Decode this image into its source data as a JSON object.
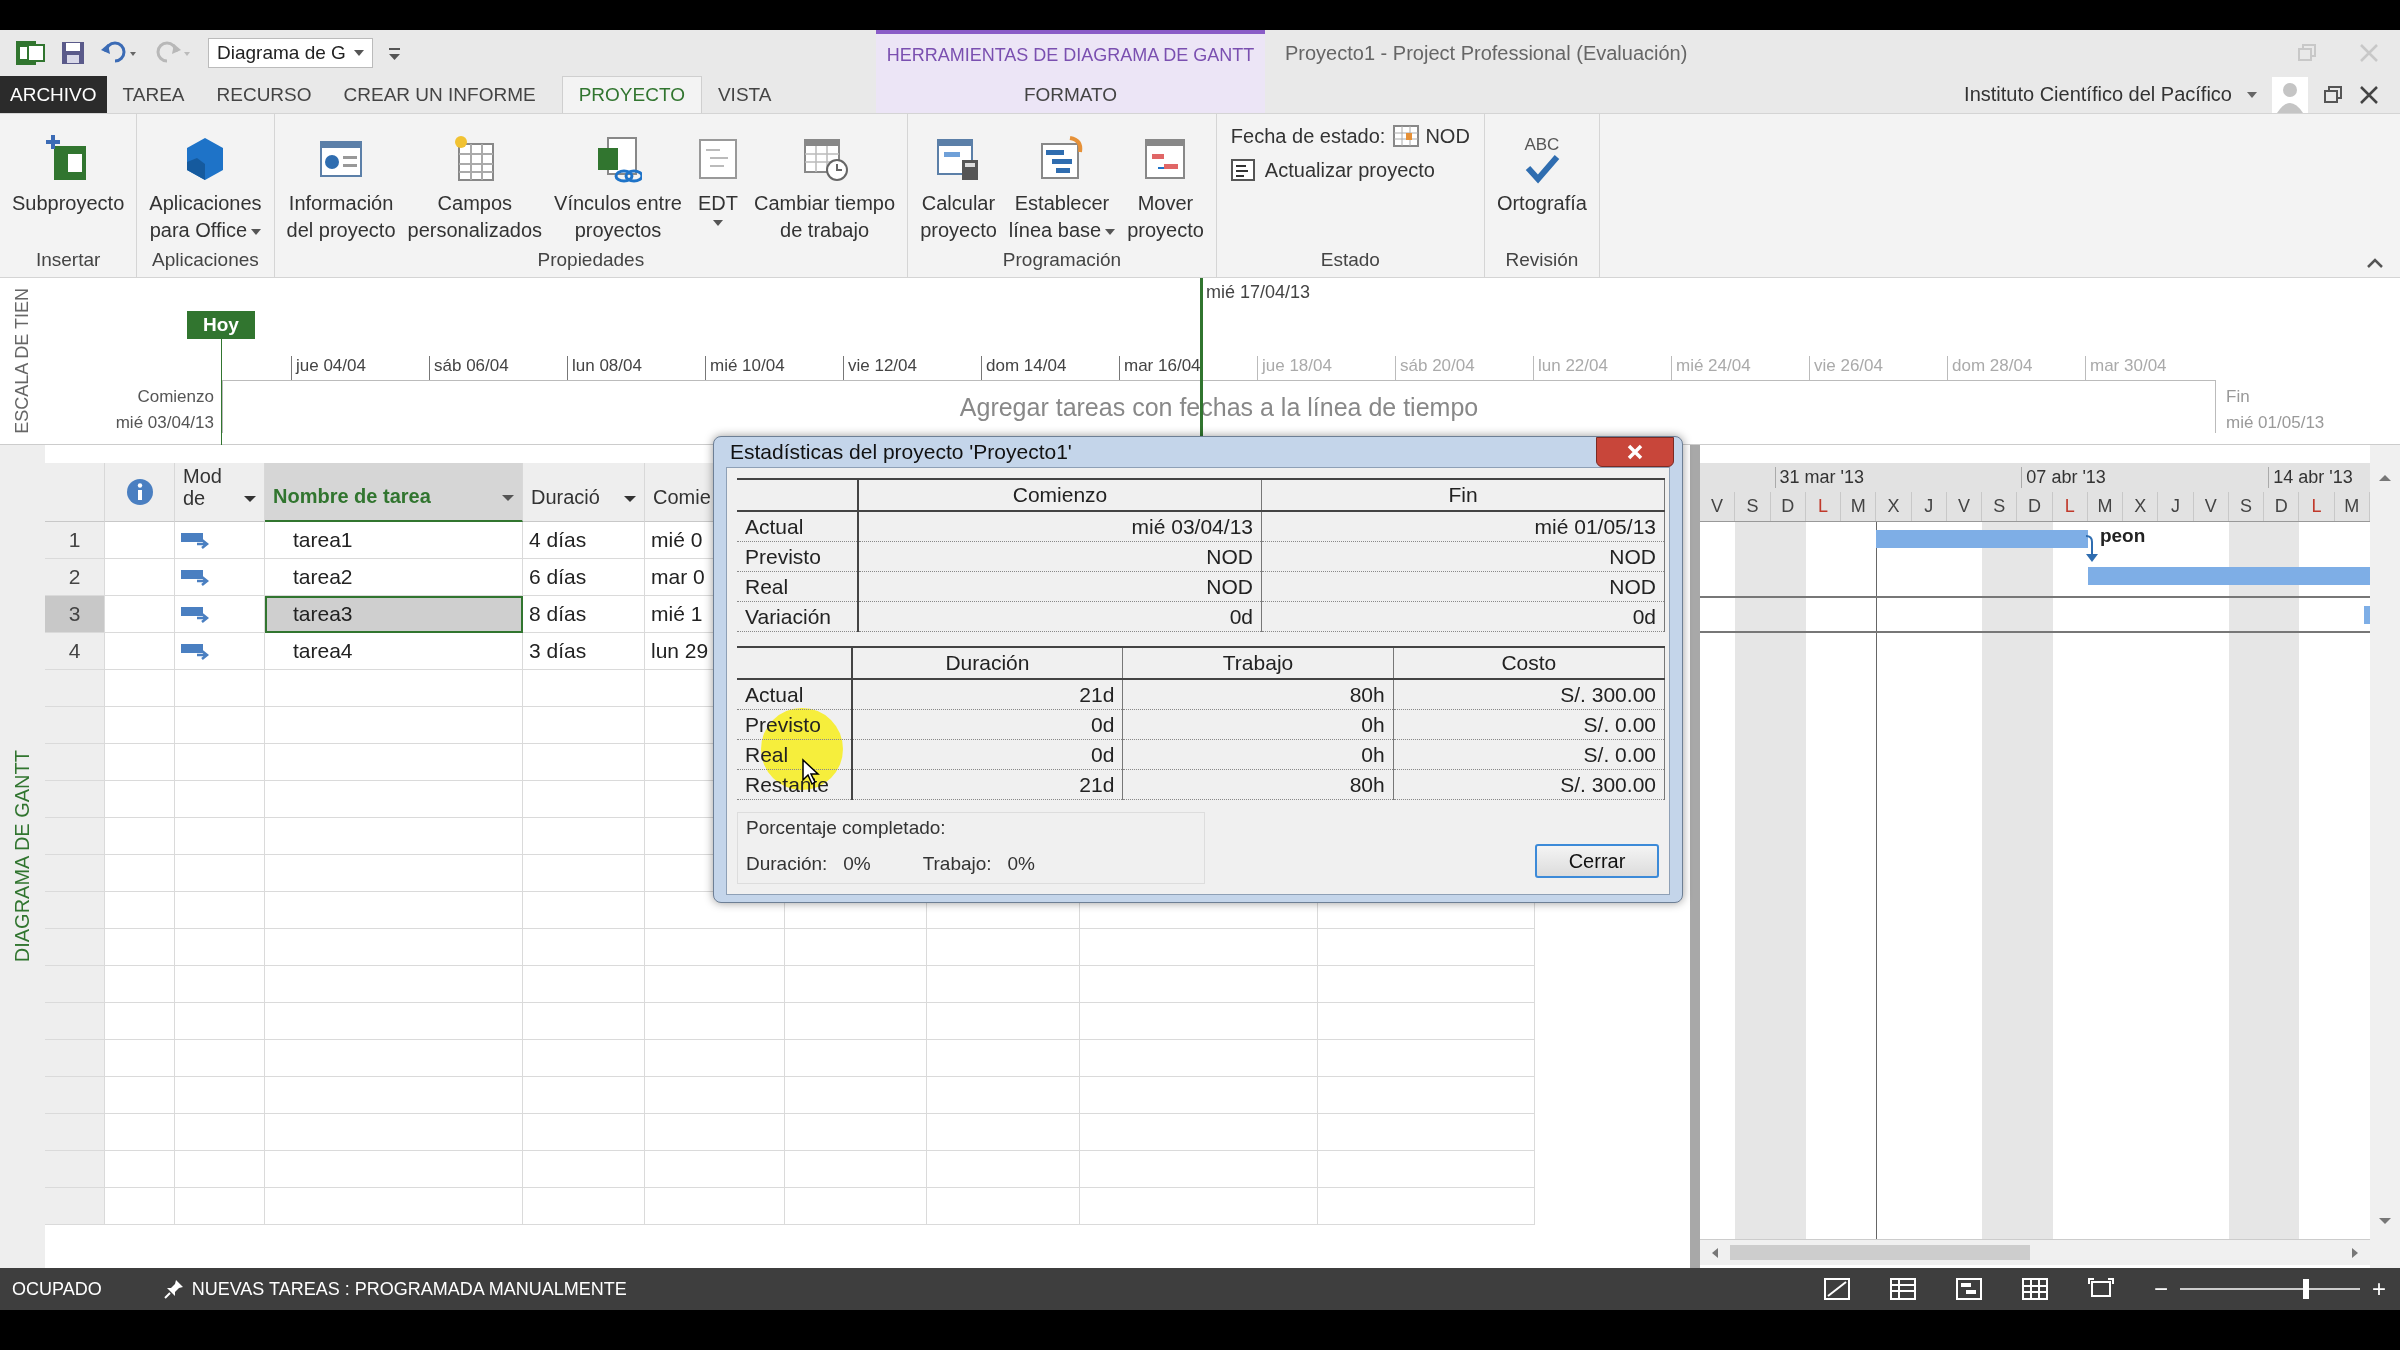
{
  "quick_access": {
    "view": "Diagrama de G"
  },
  "context_group": "HERRAMIENTAS DE DIAGRAMA DE GANTT",
  "window": {
    "title": "Proyecto1 - Project Professional (Evaluación)"
  },
  "account": "Instituto Científico del Pacífico",
  "tabs": [
    {
      "label": "ARCHIVO",
      "kind": "file",
      "selected": false
    },
    {
      "label": "TAREA",
      "kind": "normal",
      "selected": false
    },
    {
      "label": "RECURSO",
      "kind": "normal",
      "selected": false
    },
    {
      "label": "CREAR UN INFORME",
      "kind": "normal",
      "selected": false
    },
    {
      "label": "PROYECTO",
      "kind": "normal",
      "selected": true
    },
    {
      "label": "VISTA",
      "kind": "normal",
      "selected": false
    },
    {
      "label": "FORMATO",
      "kind": "context",
      "selected": false
    }
  ],
  "ribbon_groups": [
    {
      "label": "Insertar",
      "kind": "commands",
      "commands": [
        {
          "label": "Subproyecto",
          "dropdown": false
        }
      ]
    },
    {
      "label": "Aplicaciones",
      "kind": "commands",
      "commands": [
        {
          "label": "Aplicaciones\npara Office",
          "dropdown": true
        }
      ]
    },
    {
      "label": "Propiedades",
      "kind": "commands",
      "commands": [
        {
          "label": "Información\ndel proyecto",
          "dropdown": false
        },
        {
          "label": "Campos\npersonalizados",
          "dropdown": false
        },
        {
          "label": "Vínculos entre\nproyectos",
          "dropdown": false
        },
        {
          "label": "EDT",
          "dropdown": true
        },
        {
          "label": "Cambiar tiempo\nde trabajo",
          "dropdown": false
        }
      ]
    },
    {
      "label": "Programación",
      "kind": "commands",
      "commands": [
        {
          "label": "Calcular\nproyecto",
          "dropdown": false
        },
        {
          "label": "Establecer\nlínea base",
          "dropdown": true
        },
        {
          "label": "Mover\nproyecto",
          "dropdown": false
        }
      ]
    },
    {
      "label": "Estado",
      "kind": "status",
      "status_date_label": "Fecha de estado:",
      "status_date": "NOD",
      "update": "Actualizar proyecto"
    },
    {
      "label": "Revisión",
      "kind": "commands",
      "commands": [
        {
          "label": "Ortografía",
          "icon_text": "ABC",
          "dropdown": false
        }
      ]
    }
  ],
  "timeline": {
    "side_label": "ESCALA DE TIEN",
    "today": "Hoy",
    "start_label": "Comienzo",
    "start_date": "mié 03/04/13",
    "finish_label": "Fin",
    "finish_date": "mié 01/05/13",
    "current": "mié 17/04/13",
    "hint": "Agregar tareas con fechas a la línea de tiempo",
    "ticks": [
      {
        "label": "jue 04/04",
        "dimmed": false
      },
      {
        "label": "sáb 06/04",
        "dimmed": false
      },
      {
        "label": "lun 08/04",
        "dimmed": false
      },
      {
        "label": "mié 10/04",
        "dimmed": false
      },
      {
        "label": "vie 12/04",
        "dimmed": false
      },
      {
        "label": "dom 14/04",
        "dimmed": false
      },
      {
        "label": "mar 16/04",
        "dimmed": false
      },
      {
        "label": "jue 18/04",
        "dimmed": true
      },
      {
        "label": "sáb 20/04",
        "dimmed": true
      },
      {
        "label": "lun 22/04",
        "dimmed": true
      },
      {
        "label": "mié 24/04",
        "dimmed": true
      },
      {
        "label": "vie 26/04",
        "dimmed": true
      },
      {
        "label": "dom 28/04",
        "dimmed": true
      },
      {
        "label": "mar 30/04",
        "dimmed": true
      }
    ]
  },
  "table": {
    "side_label": "DIAGRAMA DE GANTT",
    "columns": {
      "mode": "Mod\nde",
      "name": "Nombre de tarea",
      "duration": "Duració",
      "start": "Comie"
    },
    "tasks": [
      {
        "number": "1",
        "name": "tarea1",
        "duration": "4 días",
        "start": "mié 0",
        "selected": false,
        "bar": {
          "resource": "peon",
          "link": true
        }
      },
      {
        "number": "2",
        "name": "tarea2",
        "duration": "6 días",
        "start": "mar 0",
        "selected": false,
        "bar": {
          "link": false
        }
      },
      {
        "number": "3",
        "name": "tarea3",
        "duration": "8 días",
        "start": "mié 1",
        "selected": true,
        "bar": {
          "link": false
        }
      },
      {
        "number": "4",
        "name": "tarea4",
        "duration": "3 días",
        "start": "lun 29",
        "selected": false
      }
    ]
  },
  "gantt": {
    "days": [
      {
        "label": "V",
        "nonworking": false,
        "color": "#444444"
      },
      {
        "label": "S",
        "nonworking": true,
        "color": "#444444"
      },
      {
        "label": "D",
        "nonworking": true,
        "color": "#444444",
        "week": "31 mar '13"
      },
      {
        "label": "L",
        "nonworking": false,
        "color": "#c0392b"
      },
      {
        "label": "M",
        "nonworking": false,
        "color": "#444444"
      },
      {
        "label": "X",
        "nonworking": false,
        "color": "#444444"
      },
      {
        "label": "J",
        "nonworking": false,
        "color": "#444444"
      },
      {
        "label": "V",
        "nonworking": false,
        "color": "#444444"
      },
      {
        "label": "S",
        "nonworking": true,
        "color": "#444444"
      },
      {
        "label": "D",
        "nonworking": true,
        "color": "#444444",
        "week": "07 abr '13"
      },
      {
        "label": "L",
        "nonworking": false,
        "color": "#c0392b"
      },
      {
        "label": "M",
        "nonworking": false,
        "color": "#444444"
      },
      {
        "label": "X",
        "nonworking": false,
        "color": "#444444"
      },
      {
        "label": "J",
        "nonworking": false,
        "color": "#444444"
      },
      {
        "label": "V",
        "nonworking": false,
        "color": "#444444"
      },
      {
        "label": "S",
        "nonworking": true,
        "color": "#444444"
      },
      {
        "label": "D",
        "nonworking": true,
        "color": "#444444",
        "week": "14 abr '13"
      },
      {
        "label": "L",
        "nonworking": false,
        "color": "#c0392b"
      },
      {
        "label": "M",
        "nonworking": false,
        "color": "#444444"
      }
    ]
  },
  "dialog": {
    "title": "Estadísticas del proyecto 'Proyecto1'",
    "dates_table": {
      "columns": [
        "Comienzo",
        "Fin"
      ],
      "rows": [
        {
          "label": "Actual",
          "values": [
            "mié 03/04/13",
            "mié 01/05/13"
          ]
        },
        {
          "label": "Previsto",
          "values": [
            "NOD",
            "NOD"
          ]
        },
        {
          "label": "Real",
          "values": [
            "NOD",
            "NOD"
          ]
        },
        {
          "label": "Variación",
          "values": [
            "0d",
            "0d"
          ]
        }
      ]
    },
    "totals_table": {
      "columns": [
        "Duración",
        "Trabajo",
        "Costo"
      ],
      "rows": [
        {
          "label": "Actual",
          "values": [
            "21d",
            "80h",
            "S/. 300.00"
          ]
        },
        {
          "label": "Previsto",
          "values": [
            "0d",
            "0h",
            "S/. 0.00"
          ]
        },
        {
          "label": "Real",
          "values": [
            "0d",
            "0h",
            "S/. 0.00"
          ]
        },
        {
          "label": "Restante",
          "values": [
            "21d",
            "80h",
            "S/. 300.00"
          ]
        }
      ]
    },
    "percent_complete": {
      "title": "Porcentaje completado:",
      "items": [
        {
          "label": "Duración:",
          "value": "0%"
        },
        {
          "label": "Trabajo:",
          "value": "0%"
        }
      ]
    },
    "buttons": [
      "Cerrar"
    ]
  },
  "status_bar": {
    "mode": "OCUPADO",
    "new_tasks": "NUEVAS TAREAS : PROGRAMADA MANUALMENTE",
    "zoom": {
      "out": "−",
      "in": "+",
      "level": 0.7
    }
  }
}
